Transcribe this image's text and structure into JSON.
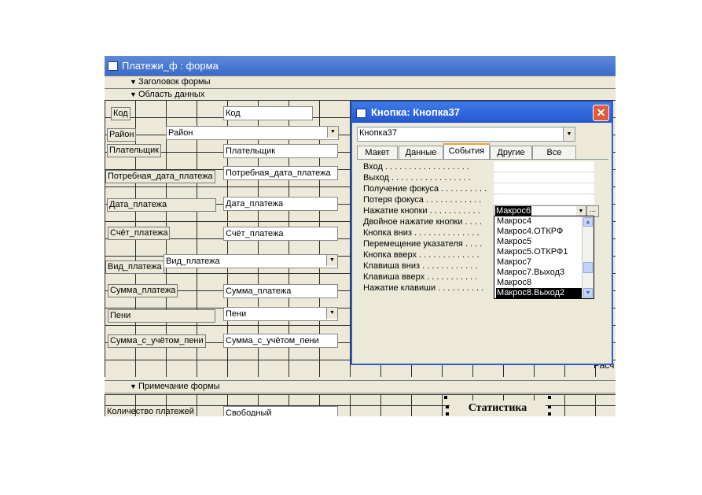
{
  "form_window": {
    "title": "Платежи_ф : форма",
    "sections": {
      "header": "Заголовок формы",
      "detail": "Область данных",
      "footer": "Примечание формы"
    },
    "detail_controls": [
      {
        "label": "Код",
        "field": "Код",
        "kind": "text"
      },
      {
        "label": "Район",
        "field": "Район",
        "kind": "combo"
      },
      {
        "label": "Плательщик",
        "field": "Плательщик",
        "kind": "text"
      },
      {
        "label": "Потребная_дата_платежа",
        "field": "Потребная_дата_платежа",
        "kind": "text"
      },
      {
        "label": "Дата_платежа",
        "field": "Дата_платежа",
        "kind": "text"
      },
      {
        "label": "Счёт_платежа",
        "field": "Счёт_платежа",
        "kind": "text"
      },
      {
        "label": "Вид_платежа",
        "field": "Вид_платежа",
        "kind": "combo"
      },
      {
        "label": "Сумма_платежа",
        "field": "Сумма_платежа",
        "kind": "text"
      },
      {
        "label": "Пени",
        "field": "Пени",
        "kind": "combo"
      },
      {
        "label": "Сумма_с_учётом_пени",
        "field": "Сумма_с_учётом_пени",
        "kind": "text"
      }
    ],
    "footer_controls": {
      "count_label": "Количество платежей",
      "count_field": "Свободный",
      "stat_button": "Статистика"
    },
    "hidden_fragment": "Расч"
  },
  "property_sheet": {
    "title": "Кнопка: Кнопка37",
    "object_selector": "Кнопка37",
    "tabs": [
      "Макет",
      "Данные",
      "События",
      "Другие",
      "Все"
    ],
    "active_tab": "События",
    "properties": [
      "Вход . . . . . . . . . . . . . . . . . .",
      "Выход . . . . . . . . . . . . . . . . .",
      "Получение фокуса . . . . . . . . . .",
      "Потеря фокуса . . . . . . . . . . . .",
      "Нажатие кнопки . . . . . . . . . . .",
      "Двойное нажатие кнопки . . . .",
      "Кнопка вниз . . . . . . . . . . . . . .",
      "Перемещение указателя . . . .",
      "Кнопка вверх . . . . . . . . . . . . .",
      "Клавиша вниз . . . . . . . . . . . .",
      "Клавиша вверх . . . . . . . . . . .",
      "Нажатие клавиши . . . . . . . . . ."
    ],
    "current_value": "Макрос6",
    "builder_label": "...",
    "macro_options": [
      "Макрос4",
      "Макрос4.ОТКРФ",
      "Макрос5",
      "Макрос5.ОТКРФ1",
      "Макрос7",
      "Макрос7.Выход3",
      "Макрос8",
      "Макрос8.Выход2"
    ],
    "selected_option": "Макрос8.Выход2"
  },
  "icons": {
    "close": "close-icon",
    "dropdown": "chevron-down-icon",
    "section_arrow": "section-arrow-icon"
  },
  "colors": {
    "titlebar": "#3a6acb",
    "dialog_titlebar": "#2557d0",
    "close_button": "#e15a39",
    "panel": "#ece9d8",
    "tab_highlight": "#e6a43b"
  }
}
